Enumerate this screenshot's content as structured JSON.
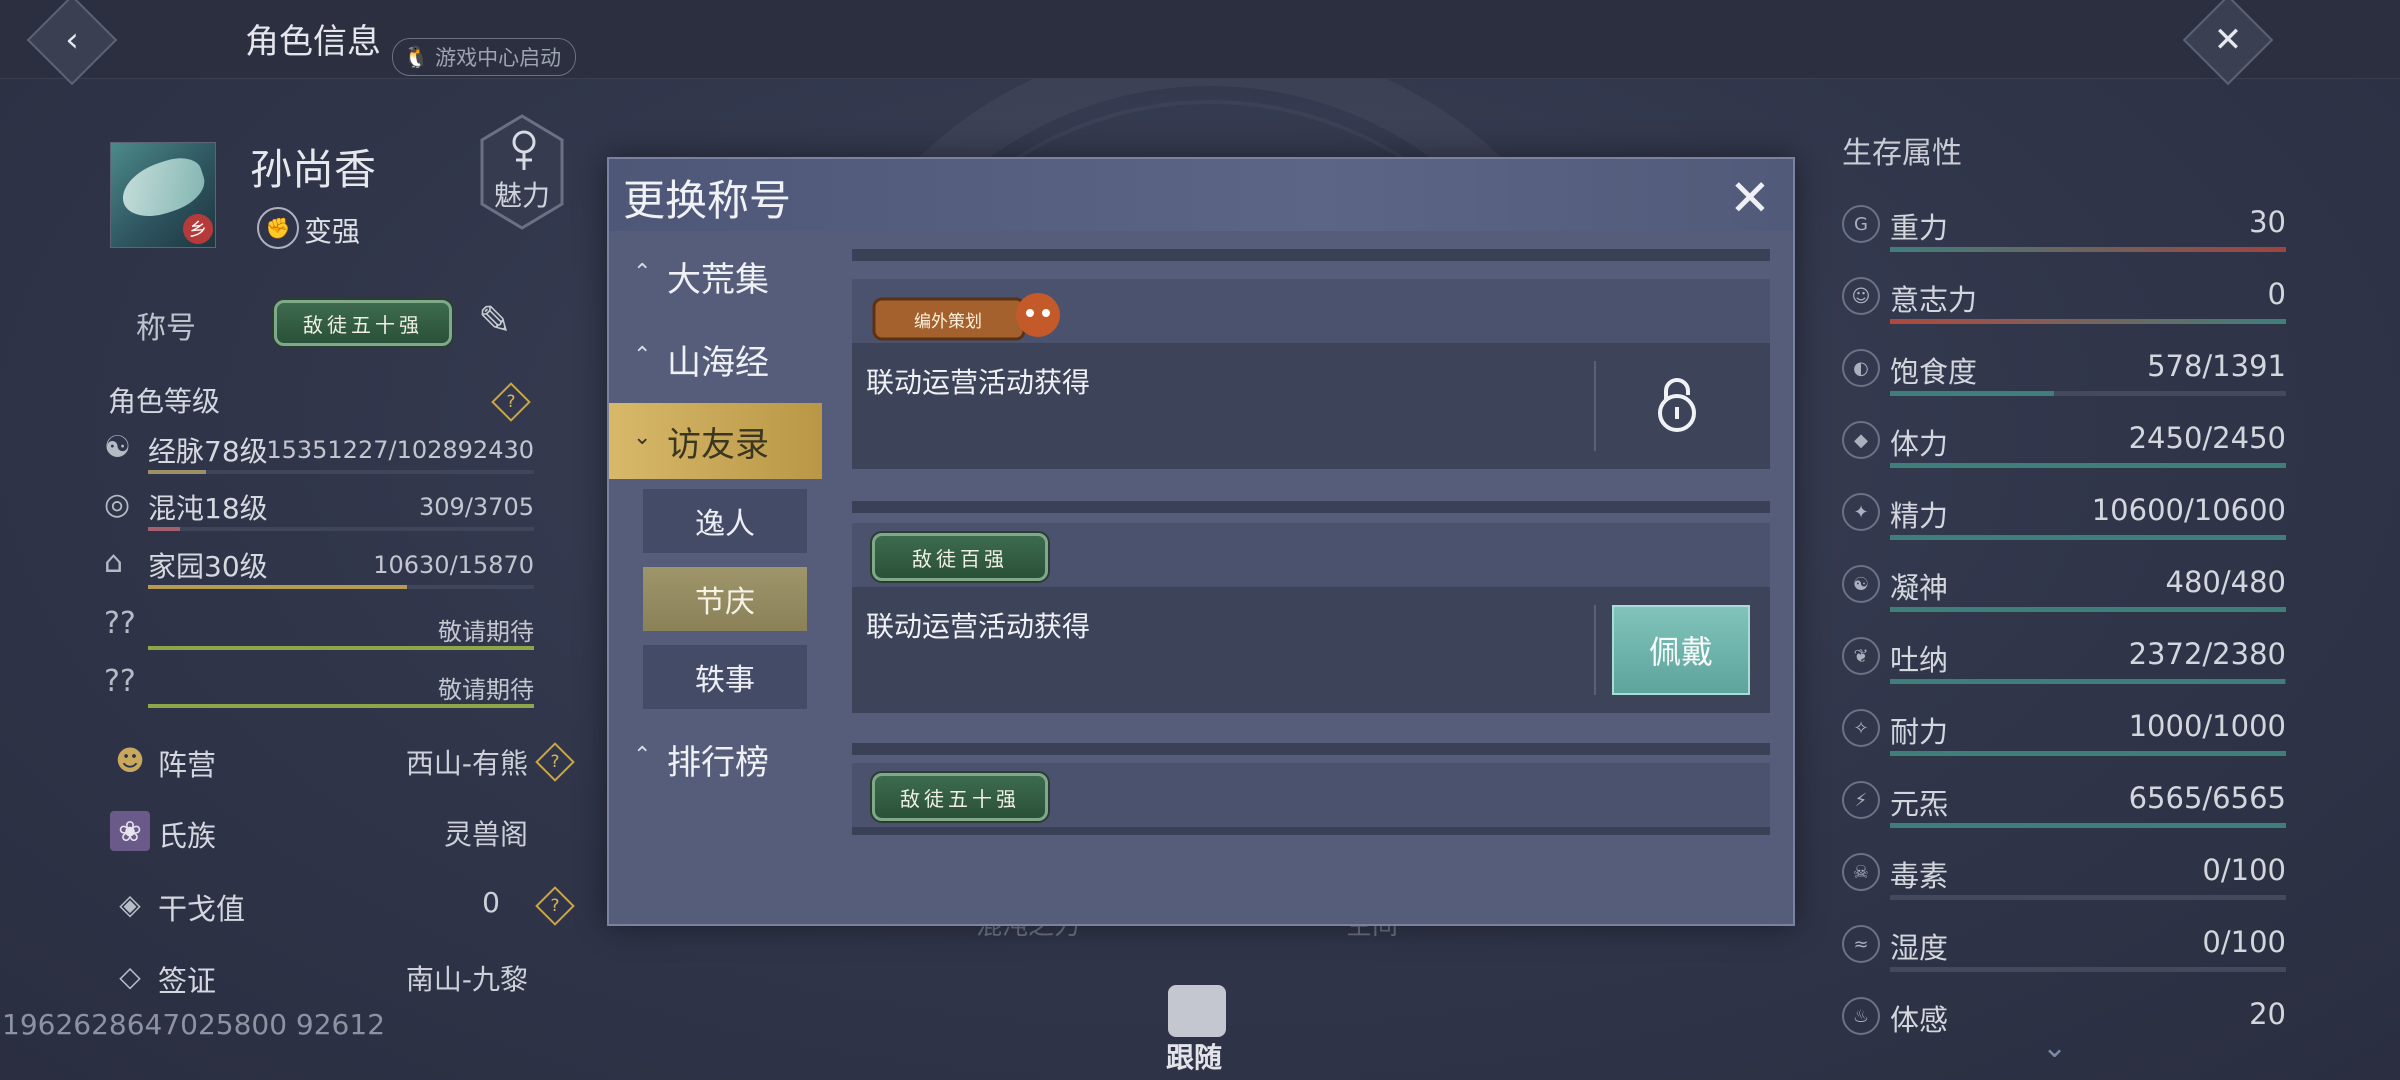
{
  "header": {
    "title": "角色信息",
    "launch_badge": "游戏中心启动"
  },
  "character": {
    "name": "孙尚香",
    "charm_label": "魅力",
    "strengthen_label": "变强",
    "title_label": "称号",
    "current_title": "敌徒五十强"
  },
  "levels": {
    "heading": "角色等级",
    "help": "?",
    "rows": [
      {
        "label": "经脉78级",
        "value": "15351227/102892430",
        "fraction": 0.149,
        "color": "#9b8f68"
      },
      {
        "label": "混沌18级",
        "value": "309/3705",
        "fraction": 0.083,
        "color": "#a56070"
      },
      {
        "label": "家园30级",
        "value": "10630/15870",
        "fraction": 0.67,
        "color": "#b59a56"
      },
      {
        "label": "敬请期待",
        "value": "敬请期待",
        "fraction": 1.0,
        "color": "#8fa54a"
      },
      {
        "label": "敬请期待",
        "value": "敬请期待",
        "fraction": 1.0,
        "color": "#8fa54a"
      }
    ],
    "unknown_icon": "??"
  },
  "info": [
    {
      "label": "阵营",
      "value": "西山-有熊"
    },
    {
      "label": "氏族",
      "value": "灵兽阁"
    },
    {
      "label": "干戈值",
      "value": "0"
    },
    {
      "label": "签证",
      "value": "南山-九黎"
    }
  ],
  "uid": "1962628647025800 92612",
  "bottom": {
    "follow_label": "跟随",
    "under_left": "混沌之力",
    "under_right": "空间"
  },
  "attributes": {
    "heading": "生存属性",
    "rows": [
      {
        "icon": "G",
        "label": "重力",
        "value": "30",
        "fraction": 1.0
      },
      {
        "icon": "☺",
        "label": "意志力",
        "value": "0",
        "fraction": 1.0
      },
      {
        "icon": "◐",
        "label": "饱食度",
        "value": "578/1391",
        "fraction": 0.415
      },
      {
        "icon": "◆",
        "label": "体力",
        "value": "2450/2450",
        "fraction": 1.0
      },
      {
        "icon": "✦",
        "label": "精力",
        "value": "10600/10600",
        "fraction": 1.0
      },
      {
        "icon": "☯",
        "label": "凝神",
        "value": "480/480",
        "fraction": 1.0
      },
      {
        "icon": "❦",
        "label": "吐纳",
        "value": "2372/2380",
        "fraction": 0.997
      },
      {
        "icon": "✧",
        "label": "耐力",
        "value": "1000/1000",
        "fraction": 1.0
      },
      {
        "icon": "⚡",
        "label": "元炁",
        "value": "6565/6565",
        "fraction": 1.0
      },
      {
        "icon": "☠",
        "label": "毒素",
        "value": "0/100",
        "fraction": 0
      },
      {
        "icon": "≈",
        "label": "湿度",
        "value": "0/100",
        "fraction": 0
      },
      {
        "icon": "♨",
        "label": "体感",
        "value": "20",
        "fraction": 0
      }
    ]
  },
  "modal": {
    "title": "更换称号",
    "nav": [
      {
        "label": "大荒集",
        "chevron": "⌃"
      },
      {
        "label": "山海经",
        "chevron": "⌃"
      },
      {
        "label": "访友录",
        "chevron": "⌄"
      },
      {
        "label": "排行榜",
        "chevron": "⌃"
      }
    ],
    "subnav": [
      "逸人",
      "节庆",
      "轶事"
    ],
    "cards": [
      {
        "badge": "编外策划",
        "desc": "联动运营活动获得",
        "action": "locked"
      },
      {
        "badge": "敌徒百强",
        "desc": "联动运营活动获得",
        "action": "佩戴"
      },
      {
        "badge": "敌徒五十强"
      }
    ]
  }
}
